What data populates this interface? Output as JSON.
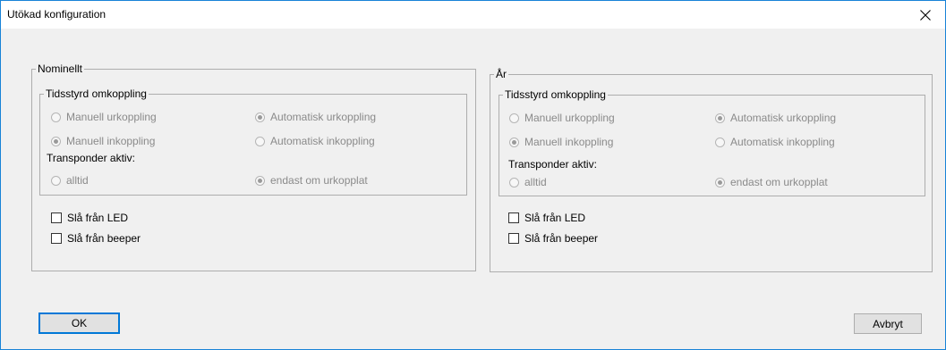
{
  "window": {
    "title": "Utökad konfiguration",
    "close_label": "×"
  },
  "panels": [
    {
      "legend": "Nominellt",
      "group_legend": "Tidsstyrd omkoppling",
      "options": {
        "manuell_urkoppling": {
          "label": "Manuell urkoppling",
          "checked": false
        },
        "automatisk_urkoppling": {
          "label": "Automatisk urkoppling",
          "checked": true
        },
        "manuell_inkoppling": {
          "label": "Manuell inkoppling",
          "checked": true
        },
        "automatisk_inkoppling": {
          "label": "Automatisk inkoppling",
          "checked": false
        }
      },
      "transponder_label": "Transponder aktiv:",
      "transponder": {
        "alltid": {
          "label": "alltid",
          "checked": false
        },
        "endast": {
          "label": "endast om urkopplat",
          "checked": true
        }
      },
      "checkboxes": {
        "led": {
          "label": "Slå från LED",
          "checked": false
        },
        "beeper": {
          "label": "Slå från beeper",
          "checked": false
        }
      }
    },
    {
      "legend": "År",
      "group_legend": "Tidsstyrd omkoppling",
      "options": {
        "manuell_urkoppling": {
          "label": "Manuell urkoppling",
          "checked": false
        },
        "automatisk_urkoppling": {
          "label": "Automatisk urkoppling",
          "checked": true
        },
        "manuell_inkoppling": {
          "label": "Manuell inkoppling",
          "checked": true
        },
        "automatisk_inkoppling": {
          "label": "Automatisk inkoppling",
          "checked": false
        }
      },
      "transponder_label": "Transponder aktiv:",
      "transponder": {
        "alltid": {
          "label": "alltid",
          "checked": false
        },
        "endast": {
          "label": "endast om urkopplat",
          "checked": true
        }
      },
      "checkboxes": {
        "led": {
          "label": "Slå från LED",
          "checked": false
        },
        "beeper": {
          "label": "Slå från beeper",
          "checked": false
        }
      }
    }
  ],
  "buttons": {
    "ok_label": "OK",
    "cancel_label": "Avbryt"
  },
  "colors": {
    "accent": "#0078d7",
    "window_border": "#1883d7",
    "disabled_text": "#8a8a8a"
  }
}
